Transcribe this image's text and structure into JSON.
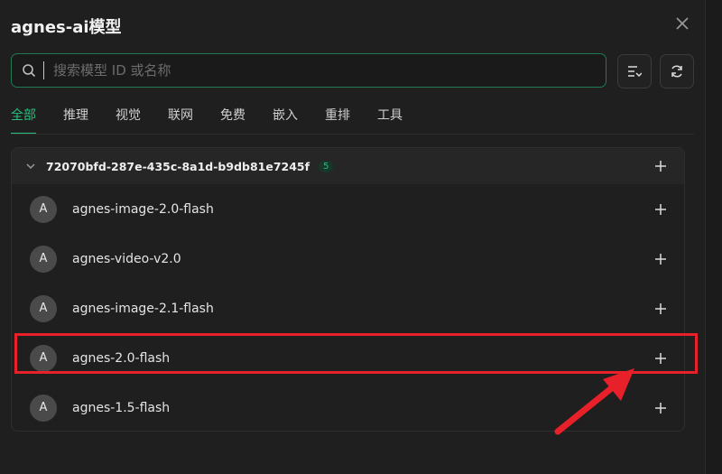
{
  "dialog": {
    "title": "agnes-ai模型"
  },
  "search": {
    "placeholder": "搜索模型 ID 或名称",
    "value": ""
  },
  "tabs": [
    {
      "label": "全部",
      "active": true
    },
    {
      "label": "推理",
      "active": false
    },
    {
      "label": "视觉",
      "active": false
    },
    {
      "label": "联网",
      "active": false
    },
    {
      "label": "免费",
      "active": false
    },
    {
      "label": "嵌入",
      "active": false
    },
    {
      "label": "重排",
      "active": false
    },
    {
      "label": "工具",
      "active": false
    }
  ],
  "group": {
    "name": "72070bfd-287e-435c-8a1d-b9db81e7245f",
    "count": "5"
  },
  "models": [
    {
      "avatar": "A",
      "name": "agnes-image-2.0-flash"
    },
    {
      "avatar": "A",
      "name": "agnes-video-v2.0"
    },
    {
      "avatar": "A",
      "name": "agnes-image-2.1-flash"
    },
    {
      "avatar": "A",
      "name": "agnes-2.0-flash"
    },
    {
      "avatar": "A",
      "name": "agnes-1.5-flash"
    }
  ],
  "colors": {
    "accent": "#28c07c",
    "highlight": "#e8202a",
    "background": "#1f1f1f"
  },
  "icons": {
    "close": "close-icon",
    "search": "search-icon",
    "manage": "list-add-icon",
    "refresh": "refresh-icon",
    "expand": "chevron-down-icon",
    "add": "plus-icon"
  }
}
